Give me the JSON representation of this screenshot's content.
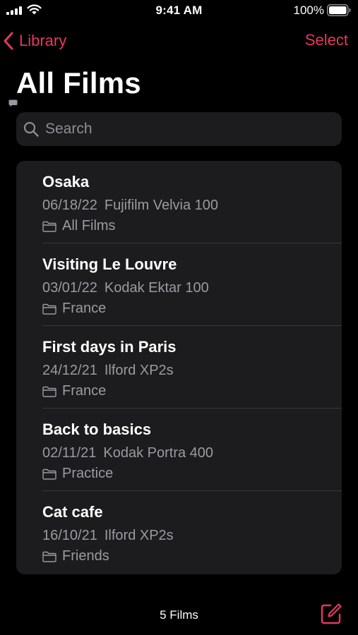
{
  "status_bar": {
    "time": "9:41 AM",
    "battery_percent": "100%"
  },
  "nav": {
    "back_label": "Library",
    "select_label": "Select"
  },
  "page": {
    "title": "All Films"
  },
  "search": {
    "placeholder": "Search",
    "value": ""
  },
  "films": [
    {
      "title": "Osaka",
      "date": "06/18/22",
      "film_stock": "Fujifilm Velvia 100",
      "folder": "All Films",
      "has_comment": false
    },
    {
      "title": "Visiting Le Louvre",
      "date": "03/01/22",
      "film_stock": "Kodak Ektar 100",
      "folder": "France",
      "has_comment": true
    },
    {
      "title": "First days in Paris",
      "date": "24/12/21",
      "film_stock": "Ilford XP2s",
      "folder": "France",
      "has_comment": false
    },
    {
      "title": "Back to basics",
      "date": "02/11/21",
      "film_stock": "Kodak Portra 400",
      "folder": "Practice",
      "has_comment": false
    },
    {
      "title": "Cat cafe",
      "date": "16/10/21",
      "film_stock": "Ilford XP2s",
      "folder": "Friends",
      "has_comment": false
    }
  ],
  "toolbar": {
    "count_label": "5 Films"
  },
  "icons": {
    "signal": "signal-icon",
    "wifi": "wifi-icon",
    "battery": "battery-icon",
    "back": "chevron-left-icon",
    "search": "search-icon",
    "folder": "folder-icon",
    "comment": "comment-icon",
    "compose": "compose-icon"
  },
  "colors": {
    "accent": "#e8375b",
    "background": "#000000",
    "surface": "#1c1c1e",
    "secondary_text": "#9a9aa0"
  }
}
